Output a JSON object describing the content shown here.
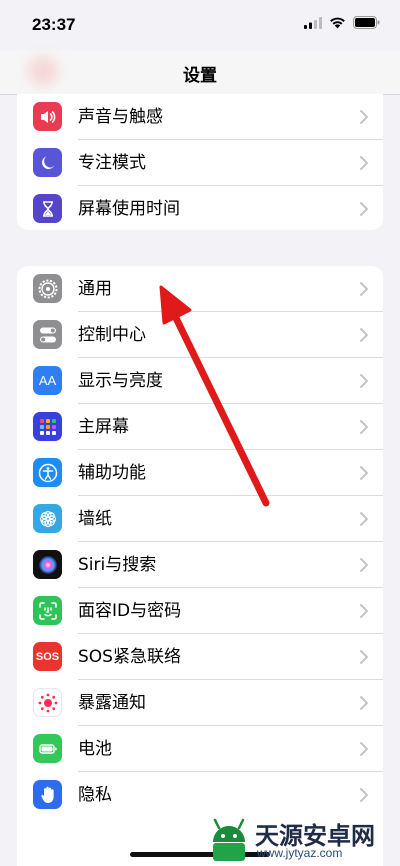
{
  "status_bar": {
    "time": "23:37",
    "icons": [
      "cellular-signal-icon",
      "wifi-icon",
      "battery-icon"
    ]
  },
  "nav": {
    "title": "设置"
  },
  "group1": [
    {
      "label": "声音与触感",
      "icon": "speaker-icon",
      "color": "#eb3b53"
    },
    {
      "label": "专注模式",
      "icon": "moon-icon",
      "color": "#5856d6"
    },
    {
      "label": "屏幕使用时间",
      "icon": "hourglass-icon",
      "color": "#5446c9"
    }
  ],
  "group2": [
    {
      "label": "通用",
      "icon": "gear-icon",
      "color": "#8e8e93"
    },
    {
      "label": "控制中心",
      "icon": "toggles-icon",
      "color": "#8e8e93"
    },
    {
      "label": "显示与亮度",
      "icon": "aa-text-icon",
      "icon_text": "AA",
      "color": "#2f7ef6"
    },
    {
      "label": "主屏幕",
      "icon": "home-grid-icon",
      "color": "#3a3fe0"
    },
    {
      "label": "辅助功能",
      "icon": "accessibility-icon",
      "color": "#1e8cf0"
    },
    {
      "label": "墙纸",
      "icon": "flower-icon",
      "color": "#35a8e3"
    },
    {
      "label": "Siri与搜索",
      "icon": "siri-icon",
      "color": "#111111"
    },
    {
      "label": "面容ID与密码",
      "icon": "face-id-icon",
      "color": "#30c35a"
    },
    {
      "label": "SOS紧急联络",
      "icon": "sos-icon",
      "icon_text": "SOS",
      "color": "#e8352e"
    },
    {
      "label": "暴露通知",
      "icon": "exposure-icon",
      "color": "#ffffff"
    },
    {
      "label": "电池",
      "icon": "battery-setting-icon",
      "color": "#34c759"
    },
    {
      "label": "隐私",
      "icon": "hand-icon",
      "color": "#2f6bef"
    }
  ],
  "annotation": {
    "arrow_color": "#e0191b"
  },
  "watermark": {
    "text": "天源安卓网",
    "url": "www.jytyaz.com",
    "logo": "android-robot-icon"
  }
}
